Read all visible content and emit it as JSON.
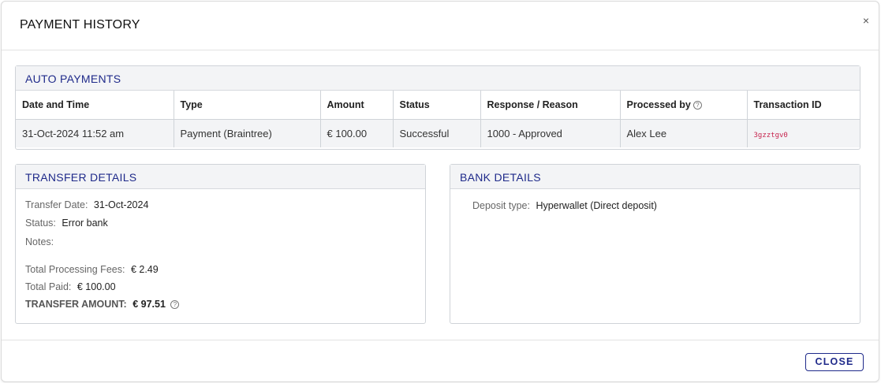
{
  "modal": {
    "title": "PAYMENT HISTORY",
    "close_icon": "×",
    "close_button": "CLOSE"
  },
  "auto_payments": {
    "heading": "AUTO PAYMENTS",
    "columns": [
      "Date and Time",
      "Type",
      "Amount",
      "Status",
      "Response / Reason",
      "Processed by",
      "Transaction ID"
    ],
    "help_icon": "?",
    "rows": [
      {
        "date_time": "31-Oct-2024 11:52 am",
        "type": "Payment (Braintree)",
        "amount": "€ 100.00",
        "status": "Successful",
        "response": "1000 - Approved",
        "processed_by": "Alex Lee",
        "transaction_id": "3gzztgv0"
      }
    ]
  },
  "transfer_details": {
    "heading": "TRANSFER DETAILS",
    "transfer_date_label": "Transfer Date:",
    "transfer_date": "31-Oct-2024",
    "status_label": "Status:",
    "status": "Error bank",
    "notes_label": "Notes:",
    "fees_label": "Total Processing Fees:",
    "fees": "€ 2.49",
    "paid_label": "Total Paid:",
    "paid": "€ 100.00",
    "amount_label": "TRANSFER AMOUNT:",
    "amount": "€ 97.51",
    "help_icon": "?"
  },
  "bank_details": {
    "heading": "BANK DETAILS",
    "deposit_label": "Deposit type:",
    "deposit": "Hyperwallet (Direct deposit)"
  },
  "colors": {
    "accent": "#1f2a8a",
    "transaction_code": "#c7254e"
  }
}
